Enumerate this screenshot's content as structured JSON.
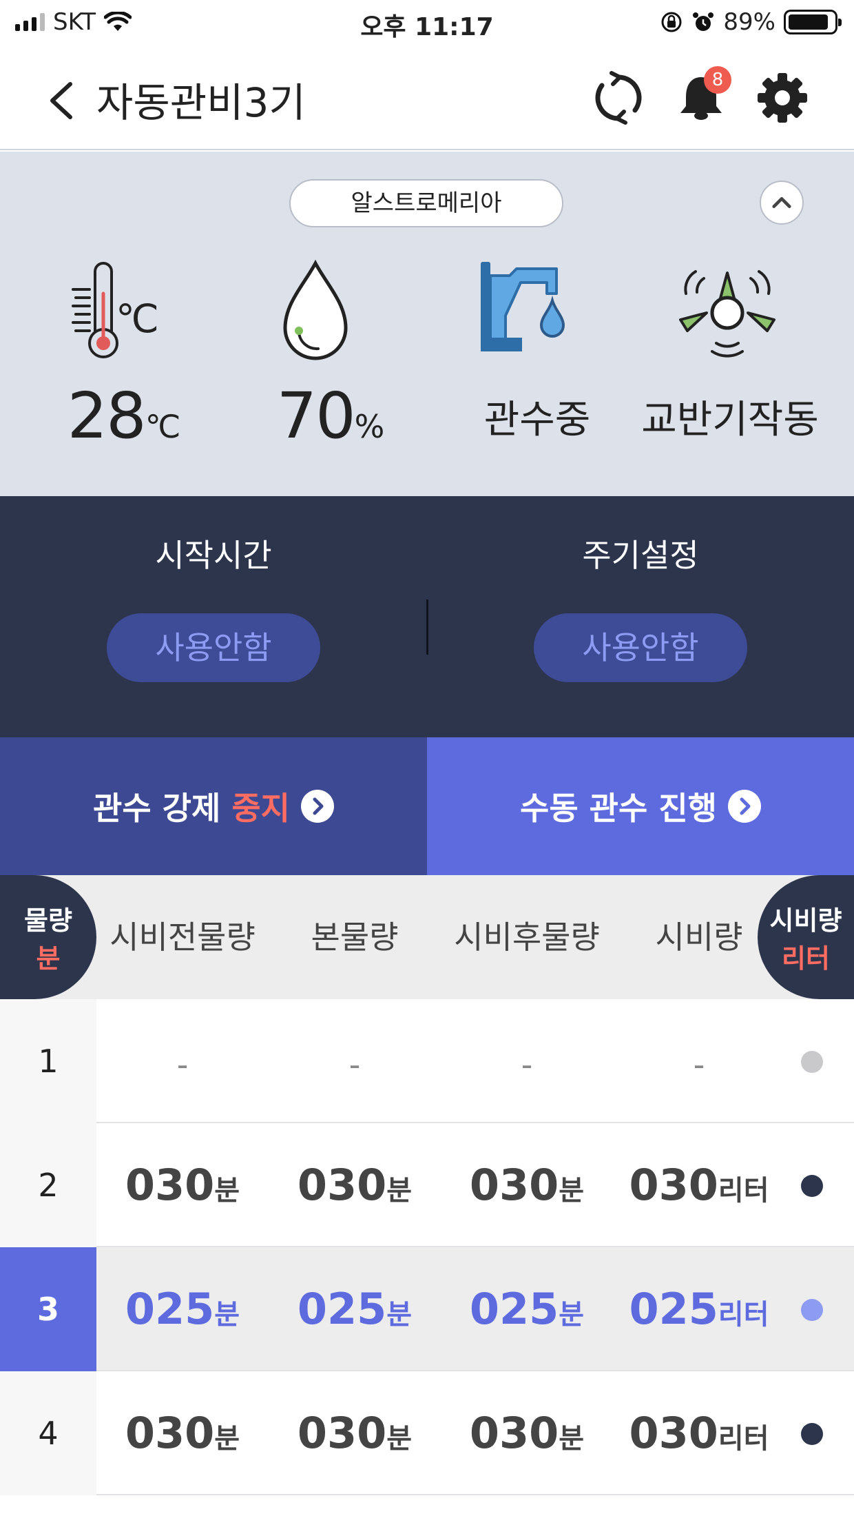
{
  "status_bar": {
    "carrier": "SKT",
    "time": "오후 11:17",
    "battery_pct": "89%",
    "battery_level": 0.89
  },
  "header": {
    "title": "자동관비3기",
    "notification_count": "8",
    "icons": [
      "back-chevron-icon",
      "refresh-icon",
      "bell-icon",
      "gear-icon"
    ]
  },
  "sensors": {
    "crop_name": "알스트로메리아",
    "temperature": {
      "value": "28",
      "unit": "℃",
      "icon": "thermometer-icon"
    },
    "humidity": {
      "value": "70",
      "unit": "%",
      "icon": "water-drop-icon"
    },
    "irrigation": {
      "status": "관수중",
      "icon": "faucet-icon"
    },
    "agitator": {
      "status": "교반기작동",
      "icon": "fan-icon"
    }
  },
  "schedule": {
    "start_time": {
      "label": "시작시간",
      "value": "사용안함"
    },
    "cycle": {
      "label": "주기설정",
      "value": "사용안함"
    }
  },
  "actions": {
    "force_stop": {
      "prefix": "관수 강제 ",
      "accent": "중지"
    },
    "manual": {
      "label": "수동 관수 진행"
    }
  },
  "table": {
    "left_toggle": {
      "line1": "물량",
      "line2": "분"
    },
    "right_toggle": {
      "line1": "시비량",
      "line2": "리터"
    },
    "columns": [
      "시비전물량",
      "본물량",
      "시비후물량",
      "시비량"
    ],
    "minute_unit": "분",
    "liter_unit": "리터",
    "rows": [
      {
        "index": "1",
        "values": [
          "-",
          "-",
          "-",
          "-"
        ],
        "status_color": "#c9c9cc"
      },
      {
        "index": "2",
        "values": [
          "030",
          "030",
          "030",
          "030"
        ],
        "status_color": "#2d354c"
      },
      {
        "index": "3",
        "values": [
          "025",
          "025",
          "025",
          "025"
        ],
        "status_color": "#8d9cf2",
        "selected": true
      },
      {
        "index": "4",
        "values": [
          "030",
          "030",
          "030",
          "030"
        ],
        "status_color": "#2d354c"
      }
    ]
  },
  "colors": {
    "navy": "#2d354c",
    "indigo": "#3d4993",
    "accent_blue": "#5e6bdf",
    "alert_red": "#ff6c62",
    "panel_gray": "#dde1ea"
  }
}
